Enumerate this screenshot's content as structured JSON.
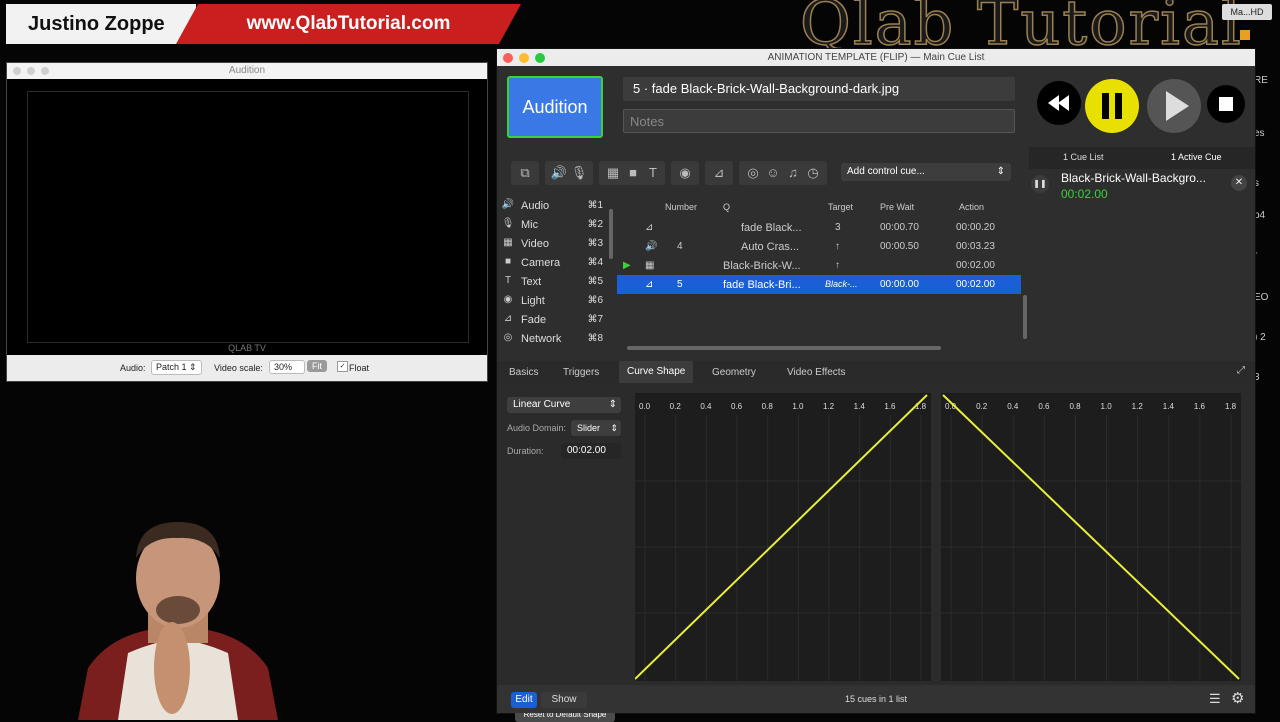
{
  "banner": {
    "name": "Justino Zoppe",
    "url": "www.QlabTutorial.com",
    "logo": "Qlab Tutorial",
    "disk": "Ma...HD"
  },
  "side_fragments": [
    "RE",
    "es",
    "s",
    "p4",
    "r",
    "EO",
    ") 2",
    "3"
  ],
  "audition_window": {
    "title": "Audition",
    "tv_label": "QLAB TV",
    "audio_label": "Audio:",
    "audio_value": "Patch 1",
    "scale_label": "Video scale:",
    "scale_value": "30%",
    "fit_label": "Fit",
    "float_label": "Float"
  },
  "main_window": {
    "title": "ANIMATION TEMPLATE (FLIP) — Main Cue List",
    "audition_button": "Audition",
    "cue_name": "5 · fade Black-Brick-Wall-Background-dark.jpg",
    "notes_placeholder": "Notes",
    "add_control": "Add control cue...",
    "cue_tabs": {
      "list": "1 Cue List",
      "active": "1 Active Cue"
    },
    "active_cue": {
      "name": "Black-Brick-Wall-Backgro...",
      "time": "00:02.00"
    },
    "cue_types": [
      {
        "icon": "speaker-icon",
        "glyph": "🔊",
        "label": "Audio",
        "shortcut": "⌘1"
      },
      {
        "icon": "mic-icon",
        "glyph": "🎙",
        "label": "Mic",
        "shortcut": "⌘2"
      },
      {
        "icon": "film-icon",
        "glyph": "▦",
        "label": "Video",
        "shortcut": "⌘3"
      },
      {
        "icon": "camera-icon",
        "glyph": "■",
        "label": "Camera",
        "shortcut": "⌘4"
      },
      {
        "icon": "text-icon",
        "glyph": "T",
        "label": "Text",
        "shortcut": "⌘5"
      },
      {
        "icon": "bulb-icon",
        "glyph": "◉",
        "label": "Light",
        "shortcut": "⌘6"
      },
      {
        "icon": "fade-icon",
        "glyph": "⊿",
        "label": "Fade",
        "shortcut": "⌘7"
      },
      {
        "icon": "network-icon",
        "glyph": "◎",
        "label": "Network",
        "shortcut": "⌘8"
      }
    ],
    "table_headers": {
      "number": "Number",
      "q": "Q",
      "target": "Target",
      "prewait": "Pre Wait",
      "action": "Action"
    },
    "cues": [
      {
        "type": "fade-icon",
        "glyph": "⊿",
        "number": "",
        "q": "fade Black...",
        "target": "3",
        "prewait": "00:00.70",
        "action": "00:00.20",
        "selected": false,
        "playing": false
      },
      {
        "type": "speaker-icon",
        "glyph": "🔊",
        "number": "4",
        "q": "Auto Cras...",
        "target": "↑",
        "prewait": "00:00.50",
        "action": "00:03.23",
        "selected": false,
        "playing": false
      },
      {
        "type": "film-icon",
        "glyph": "▦",
        "number": "",
        "q": "Black-Brick-W...",
        "target": "↑",
        "prewait": "",
        "action": "00:02.00",
        "selected": false,
        "playing": true
      },
      {
        "type": "fade-icon",
        "glyph": "⊿",
        "number": "5",
        "q": "fade Black-Bri...",
        "target": "Black-...",
        "prewait": "00:00.00",
        "action": "00:02.00",
        "selected": true,
        "playing": false
      }
    ],
    "inspector_tabs": [
      "Basics",
      "Triggers",
      "Curve Shape",
      "Geometry",
      "Video Effects"
    ],
    "active_tab": "Curve Shape",
    "curve": {
      "shape": "Linear Curve",
      "domain_label": "Audio Domain:",
      "domain": "Slider",
      "duration_label": "Duration:",
      "duration": "00:02.00",
      "reset": "Reset to Default Shape"
    },
    "ticks": [
      "0.0",
      "0.2",
      "0.4",
      "0.6",
      "0.8",
      "1.0",
      "1.2",
      "1.4",
      "1.6",
      "1.8"
    ],
    "bottom": {
      "edit": "Edit",
      "show": "Show",
      "count": "15 cues in 1 list"
    }
  },
  "colors": {
    "accent": "#3a78e6",
    "selection": "#1a5fd6",
    "curve": "#e6ef3a",
    "pause": "#e8e000",
    "go_green": "#3ad23a"
  }
}
